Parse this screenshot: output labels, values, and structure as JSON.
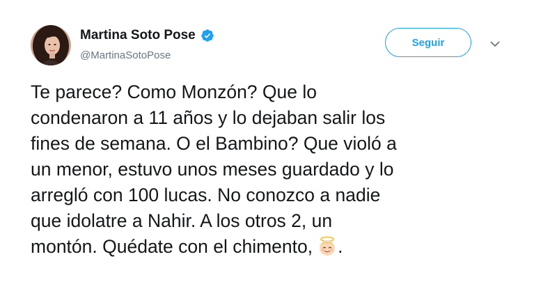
{
  "user": {
    "display_name": "Martina Soto Pose",
    "handle": "@MartinaSotoPose",
    "verified": true,
    "avatar_icon": "profile-photo"
  },
  "actions": {
    "follow_label": "Seguir",
    "more_icon": "chevron-down-icon"
  },
  "tweet": {
    "lines": [
      "Te parece? Como Monzón? Que lo",
      "condenaron a 11 años y lo dejaban salir los",
      "fines de semana. O el Bambino? Que violó a",
      "un menor, estuvo unos meses guardado y lo",
      "arregló con 100 lucas. No conozco a nadie",
      "que idolatre a Nahir. A los otros 2, un",
      "montón. Quédate con el chimento,"
    ],
    "trailing_emoji": "angel-emoji",
    "trailing_text": "."
  },
  "colors": {
    "brand_blue": "#1da1f2",
    "text": "#14171a",
    "secondary_text": "#657786"
  }
}
